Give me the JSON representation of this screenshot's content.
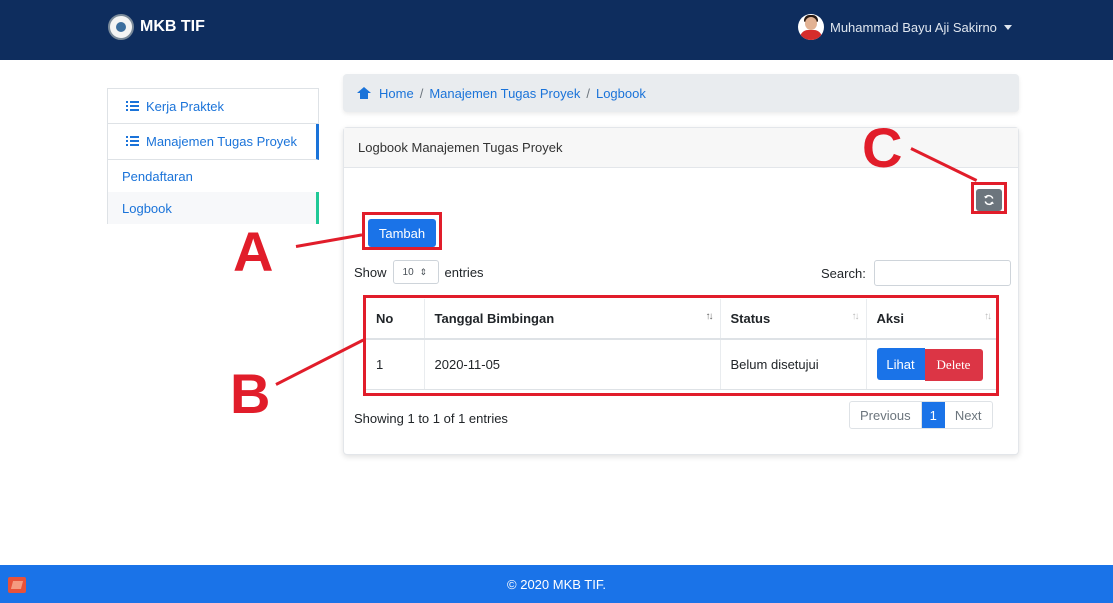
{
  "app": {
    "brand": "MKB TIF"
  },
  "user": {
    "name": "Muhammad Bayu Aji Sakirno"
  },
  "sidebar": {
    "items": [
      {
        "label": "Kerja Praktek"
      },
      {
        "label": "Manajemen Tugas Proyek"
      }
    ],
    "sub_items": [
      {
        "label": "Pendaftaran"
      },
      {
        "label": "Logbook"
      }
    ]
  },
  "breadcrumb": {
    "home": "Home",
    "section": "Manajemen Tugas Proyek",
    "page": "Logbook"
  },
  "card": {
    "title": "Logbook Manajemen Tugas Proyek",
    "add_button": "Tambah",
    "show_label": "Show",
    "entries_select": "10",
    "entries_label": "entries",
    "search_label": "Search:",
    "search_value": ""
  },
  "table": {
    "headers": [
      "No",
      "Tanggal Bimbingan",
      "Status",
      "Aksi"
    ],
    "rows": [
      {
        "no": "1",
        "date": "2020-11-05",
        "status": "Belum disetujui",
        "view": "Lihat",
        "delete": "Delete"
      }
    ]
  },
  "footer_info": "Showing 1 to 1 of 1 entries",
  "pagination": {
    "prev": "Previous",
    "current": "1",
    "next": "Next"
  },
  "annotations": {
    "a": "A",
    "b": "B",
    "c": "C",
    "color": "#e11d2a"
  },
  "footer": {
    "text": "© 2020 MKB TIF."
  }
}
